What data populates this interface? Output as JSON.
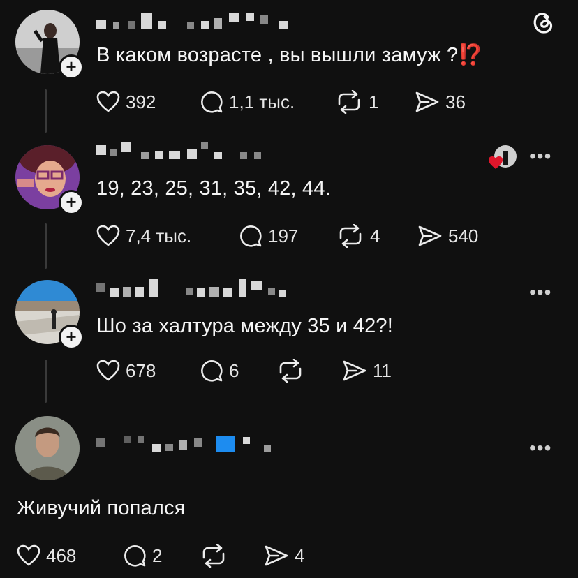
{
  "posts": [
    {
      "text": "В каком возрасте , вы вышли замуж ?⁉️",
      "likes": "392",
      "replies": "1,1 тыс.",
      "reposts": "1",
      "shares": "36"
    },
    {
      "text": "19, 23, 25, 31, 35, 42, 44.",
      "likes": "7,4 тыс.",
      "replies": "197",
      "reposts": "4",
      "shares": "540"
    },
    {
      "text": "Шо за халтура между 35 и 42?!",
      "likes": "678",
      "replies": "6",
      "reposts": "",
      "shares": "11"
    },
    {
      "text": "Живучий попался",
      "likes": "468",
      "replies": "2",
      "reposts": "",
      "shares": "4"
    }
  ],
  "more_glyph": "•••",
  "icons": [
    "threads-logo-icon",
    "heart-icon",
    "comment-icon",
    "repost-icon",
    "share-icon",
    "plus-icon",
    "more-icon"
  ],
  "colors": {
    "background": "#101010",
    "text": "#f3f3f3",
    "accent_red": "#e0162b",
    "verified_blue": "#1d8cf0"
  }
}
